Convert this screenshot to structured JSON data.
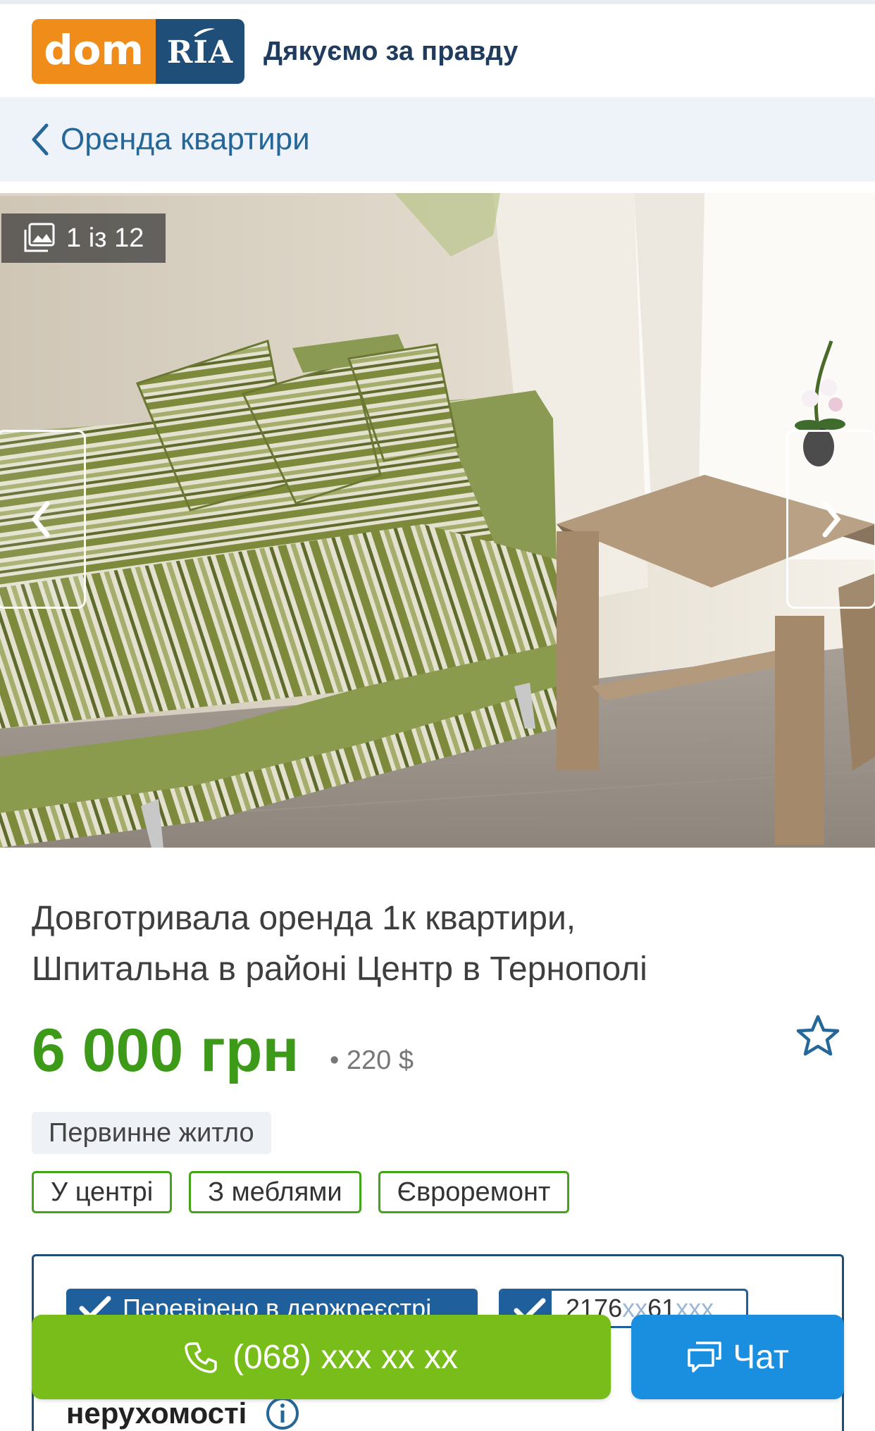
{
  "header": {
    "logo_dom": "dom",
    "logo_ria": "RIA",
    "slogan": "Дякуємо за правду"
  },
  "breadcrumb": {
    "back_label": "Оренда квартири"
  },
  "gallery": {
    "counter": "1 із 12",
    "current_photo": 1,
    "total_photos": 12,
    "prev_icon": "chevron-left-icon",
    "next_icon": "chevron-right-icon"
  },
  "listing": {
    "title_line1": "Довготривала оренда 1к квартири,",
    "title_line2": "Шпитальна в районі Центр в Тернополі",
    "price": "6 000 грн",
    "price_usd": "• 220 $",
    "favorite_icon": "star-outline-icon",
    "primary_badge": "Первинне житло",
    "tags": [
      "У центрі",
      "З меблями",
      "Євроремонт"
    ]
  },
  "verification": {
    "verified_label": "Перевірено в держреєстрі",
    "registry_number": "2176",
    "registry_mask_1": "xx",
    "registry_mid": "61",
    "registry_mask_2": "xxx",
    "realty_label": "нерухомості",
    "info_icon": "info-icon"
  },
  "actions": {
    "call_label": "(068) xxx xx xx",
    "chat_label": "Чат"
  },
  "colors": {
    "brand_orange": "#f08c1a",
    "brand_navy": "#1f4e79",
    "price_green": "#3d9a19",
    "call_green": "#79bd1a",
    "chat_blue": "#1a8fe0"
  }
}
